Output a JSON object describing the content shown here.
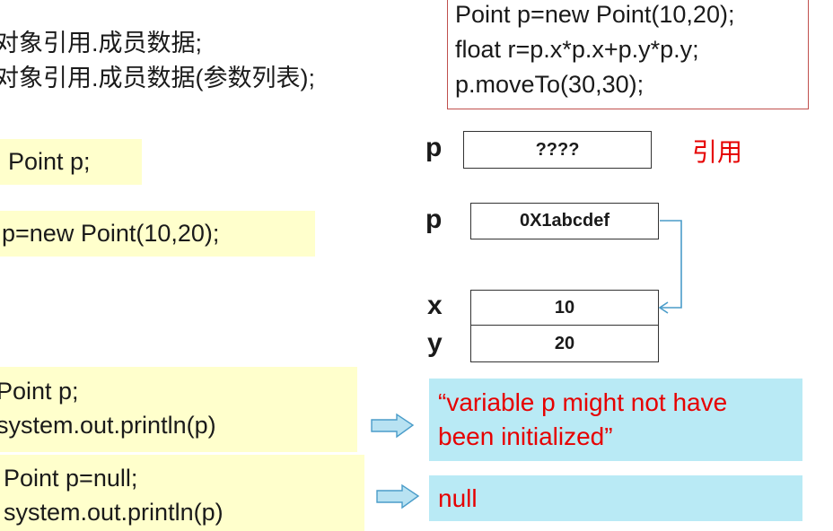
{
  "syntax_lines": [
    "对象引用.成员数据;",
    "对象引用.成员数据(参数列表);"
  ],
  "code_box": [
    "Point p=new Point(10,20);",
    "float r=p.x*p.x+p.y*p.y;",
    "p.moveTo(30,30);"
  ],
  "declare_label": "Point p;",
  "new_label": "p=new Point(10,20);",
  "memory": {
    "p1_label": "p",
    "p1_value": "????",
    "reference_label": "引用",
    "p2_label": "p",
    "p2_value": "0X1abcdef",
    "x_label": "x",
    "x_value": "10",
    "y_label": "y",
    "y_value": "20"
  },
  "example1": {
    "code": [
      "Point p;",
      "system.out.println(p)"
    ],
    "result": [
      "“variable p might not have",
      "been initialized”"
    ]
  },
  "example2": {
    "code": [
      "Point p=null;",
      "system.out.println(p)"
    ],
    "result": "null"
  },
  "colors": {
    "yellow_box": "#ffffcc",
    "blue_box": "#b9eaf5",
    "red_text": "#e60000",
    "arrow_fill": "#b8e2f2",
    "arrow_stroke": "#4a9cc9",
    "code_border": "#c0504d"
  }
}
